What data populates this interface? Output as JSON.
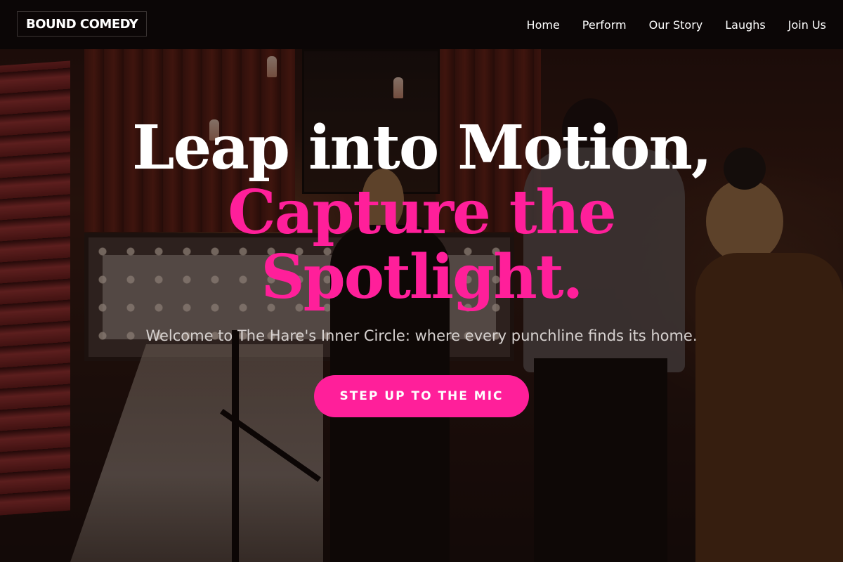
{
  "navbar": {
    "brand": "BOUND COMEDY",
    "links": [
      {
        "label": "Home"
      },
      {
        "label": "Perform"
      },
      {
        "label": "Our Story"
      },
      {
        "label": "Laughs"
      },
      {
        "label": "Join Us"
      }
    ]
  },
  "hero": {
    "headline_line1": "Leap into Motion,",
    "headline_accent": "Capture the Spotlight.",
    "subtitle": "Welcome to The Hare's Inner Circle: where every punchline finds its home.",
    "cta_label": "STEP UP TO THE MIC",
    "background_image": "comedy-club-stairway-photo"
  },
  "colors": {
    "accent": "#ff1f9a",
    "navbar_bg": "#0b0606",
    "text_light": "#ffffff",
    "subtitle_text": "#d7d2d0"
  }
}
